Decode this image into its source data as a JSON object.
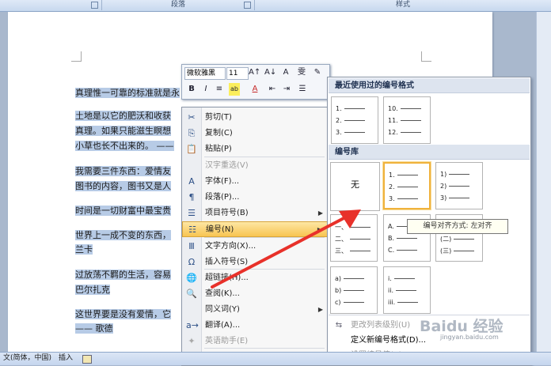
{
  "ribbon": {
    "groups": [
      "",
      "段落",
      "样式"
    ]
  },
  "document": {
    "paragraphs": [
      "真理惟一可靠的标准就是永",
      "土地是以它的肥沃和收获",
      "真理。如果只能滋生瞑想",
      "小草也长不出来的。 ——",
      "我需要三件东西：爱情友",
      "图书的内容，图书又是人",
      "时间是一切财富中最宝贵",
      "世界上一成不变的东西，",
      "兰卡",
      "过放荡不羁的生活，容易",
      "巴尔扎克",
      "这世界要是没有爱情，它",
      "—— 歌德"
    ]
  },
  "mini_toolbar": {
    "font_name": "微软雅黑",
    "font_size": "11",
    "row1_buttons": [
      "A↑",
      "A↓",
      "A",
      "雯",
      "✎"
    ],
    "row2_buttons": [
      "B",
      "I",
      "≡",
      "ab",
      "A",
      "⇤",
      "⇥",
      "☰"
    ]
  },
  "context_menu": {
    "items": [
      {
        "icon": "✂",
        "label": "剪切(T)",
        "enabled": true
      },
      {
        "icon": "⎘",
        "label": "复制(C)",
        "enabled": true
      },
      {
        "icon": "📋",
        "label": "粘贴(P)",
        "enabled": true
      },
      {
        "icon": "",
        "label": "汉字重选(V)",
        "enabled": false
      },
      {
        "icon": "A",
        "label": "字体(F)...",
        "enabled": true
      },
      {
        "icon": "¶",
        "label": "段落(P)...",
        "enabled": true
      },
      {
        "icon": "☰",
        "label": "项目符号(B)",
        "enabled": true,
        "submenu": true
      },
      {
        "icon": "☷",
        "label": "编号(N)",
        "enabled": true,
        "submenu": true,
        "selected": true
      },
      {
        "icon": "Ⅲ",
        "label": "文字方向(X)...",
        "enabled": true
      },
      {
        "icon": "Ω",
        "label": "插入符号(S)",
        "enabled": true
      },
      {
        "icon": "🌐",
        "label": "超链接(H)...",
        "enabled": true
      },
      {
        "icon": "🔍",
        "label": "查阅(K)...",
        "enabled": true
      },
      {
        "icon": "",
        "label": "同义词(Y)",
        "enabled": true,
        "submenu": true
      },
      {
        "icon": "a→",
        "label": "翻译(A)...",
        "enabled": true
      },
      {
        "icon": "✦",
        "label": "英语助手(E)",
        "enabled": false
      },
      {
        "icon": "",
        "label": "样式(T)",
        "enabled": true,
        "submenu": true
      }
    ]
  },
  "gallery": {
    "recent_header": "最近使用过的编号格式",
    "library_header": "编号库",
    "recent": [
      [
        "1.",
        "2.",
        "3."
      ],
      [
        "10.",
        "11.",
        "12."
      ]
    ],
    "library": [
      {
        "none": "无"
      },
      {
        "lines": [
          "1.",
          "2.",
          "3."
        ]
      },
      {
        "lines": [
          "1)",
          "2)",
          "3)"
        ]
      },
      {
        "lines": [
          "一、",
          "二、",
          "三、"
        ]
      },
      {
        "lines": [
          "A.",
          "B.",
          "C."
        ]
      },
      {
        "lines": [
          "(一)",
          "(二)",
          "(三)"
        ]
      },
      {
        "lines": [
          "a)",
          "b)",
          "c)"
        ]
      },
      {
        "lines": [
          "i.",
          "ii.",
          "iii."
        ]
      }
    ],
    "actions": [
      {
        "label": "更改列表级别(U)",
        "enabled": false
      },
      {
        "label": "定义新编号格式(D)...",
        "enabled": true
      },
      {
        "label": "设置编号值(V)...",
        "enabled": false
      }
    ]
  },
  "tooltip": "编号对齐方式: 左对齐",
  "status_bar": {
    "language": "文(简体，中国)",
    "mode": "插入"
  },
  "watermark": {
    "brand": "Baidu 经验",
    "url": "jingyan.baidu.com"
  },
  "colors": {
    "highlight": "#b7cbe6",
    "menu_selected": "#f8c451",
    "arrow": "#e8312a"
  }
}
